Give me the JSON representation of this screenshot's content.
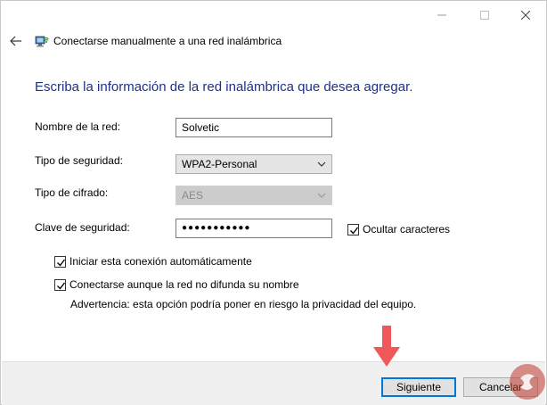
{
  "window": {
    "title": "Conectarse manualmente a una red inalámbrica",
    "controls": [
      "minimize",
      "maximize",
      "close"
    ]
  },
  "heading": "Escriba la información de la red inalámbrica que desea agregar.",
  "form": {
    "network_name": {
      "label": "Nombre de la red:",
      "value": "Solvetic"
    },
    "security_type": {
      "label": "Tipo de seguridad:",
      "value": "WPA2-Personal"
    },
    "encryption_type": {
      "label": "Tipo de cifrado:",
      "value": "AES",
      "disabled": true
    },
    "security_key": {
      "label": "Clave de seguridad:",
      "value": "●●●●●●●●●●●"
    },
    "hide_characters": {
      "label": "Ocultar caracteres",
      "checked": true
    },
    "auto_connect": {
      "label": "Iniciar esta conexión automáticamente",
      "checked": true
    },
    "connect_hidden": {
      "label": "Conectarse aunque la red no difunda su nombre",
      "checked": true
    },
    "warning": "Advertencia: esta opción podría poner en riesgo la privacidad del equipo."
  },
  "buttons": {
    "next": "Siguiente",
    "cancel": "Cancelar"
  },
  "colors": {
    "heading": "#1e3287",
    "focus": "#0078d7",
    "arrow": "#f0575a"
  },
  "icons": [
    "back-arrow-icon",
    "wireless-network-icon",
    "chevron-down-icon",
    "checkmark-icon",
    "solvetic-logo"
  ]
}
